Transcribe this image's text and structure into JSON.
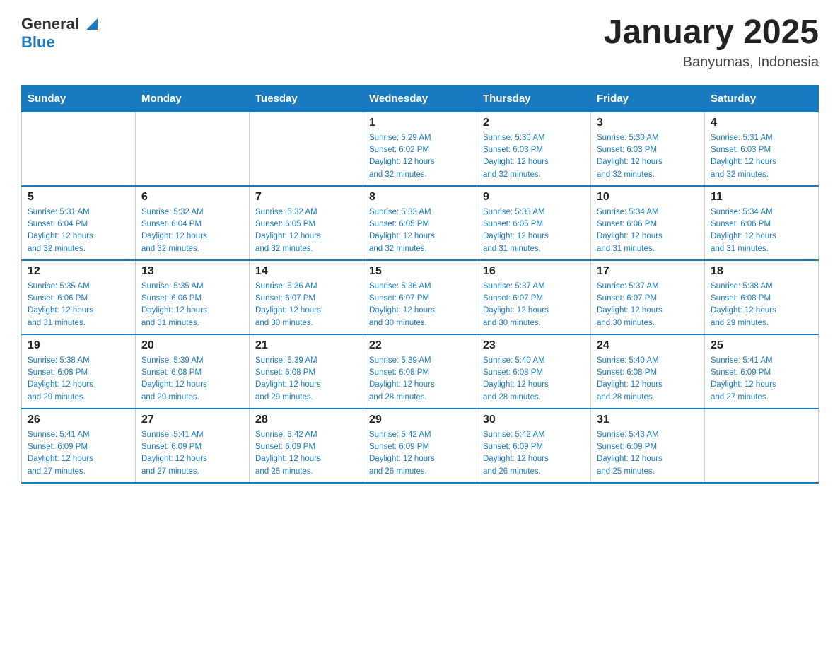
{
  "header": {
    "logo_text_general": "General",
    "logo_text_blue": "Blue",
    "month_title": "January 2025",
    "location": "Banyumas, Indonesia"
  },
  "days_of_week": [
    "Sunday",
    "Monday",
    "Tuesday",
    "Wednesday",
    "Thursday",
    "Friday",
    "Saturday"
  ],
  "weeks": [
    [
      {
        "day": "",
        "info": ""
      },
      {
        "day": "",
        "info": ""
      },
      {
        "day": "",
        "info": ""
      },
      {
        "day": "1",
        "info": "Sunrise: 5:29 AM\nSunset: 6:02 PM\nDaylight: 12 hours\nand 32 minutes."
      },
      {
        "day": "2",
        "info": "Sunrise: 5:30 AM\nSunset: 6:03 PM\nDaylight: 12 hours\nand 32 minutes."
      },
      {
        "day": "3",
        "info": "Sunrise: 5:30 AM\nSunset: 6:03 PM\nDaylight: 12 hours\nand 32 minutes."
      },
      {
        "day": "4",
        "info": "Sunrise: 5:31 AM\nSunset: 6:03 PM\nDaylight: 12 hours\nand 32 minutes."
      }
    ],
    [
      {
        "day": "5",
        "info": "Sunrise: 5:31 AM\nSunset: 6:04 PM\nDaylight: 12 hours\nand 32 minutes."
      },
      {
        "day": "6",
        "info": "Sunrise: 5:32 AM\nSunset: 6:04 PM\nDaylight: 12 hours\nand 32 minutes."
      },
      {
        "day": "7",
        "info": "Sunrise: 5:32 AM\nSunset: 6:05 PM\nDaylight: 12 hours\nand 32 minutes."
      },
      {
        "day": "8",
        "info": "Sunrise: 5:33 AM\nSunset: 6:05 PM\nDaylight: 12 hours\nand 32 minutes."
      },
      {
        "day": "9",
        "info": "Sunrise: 5:33 AM\nSunset: 6:05 PM\nDaylight: 12 hours\nand 31 minutes."
      },
      {
        "day": "10",
        "info": "Sunrise: 5:34 AM\nSunset: 6:06 PM\nDaylight: 12 hours\nand 31 minutes."
      },
      {
        "day": "11",
        "info": "Sunrise: 5:34 AM\nSunset: 6:06 PM\nDaylight: 12 hours\nand 31 minutes."
      }
    ],
    [
      {
        "day": "12",
        "info": "Sunrise: 5:35 AM\nSunset: 6:06 PM\nDaylight: 12 hours\nand 31 minutes."
      },
      {
        "day": "13",
        "info": "Sunrise: 5:35 AM\nSunset: 6:06 PM\nDaylight: 12 hours\nand 31 minutes."
      },
      {
        "day": "14",
        "info": "Sunrise: 5:36 AM\nSunset: 6:07 PM\nDaylight: 12 hours\nand 30 minutes."
      },
      {
        "day": "15",
        "info": "Sunrise: 5:36 AM\nSunset: 6:07 PM\nDaylight: 12 hours\nand 30 minutes."
      },
      {
        "day": "16",
        "info": "Sunrise: 5:37 AM\nSunset: 6:07 PM\nDaylight: 12 hours\nand 30 minutes."
      },
      {
        "day": "17",
        "info": "Sunrise: 5:37 AM\nSunset: 6:07 PM\nDaylight: 12 hours\nand 30 minutes."
      },
      {
        "day": "18",
        "info": "Sunrise: 5:38 AM\nSunset: 6:08 PM\nDaylight: 12 hours\nand 29 minutes."
      }
    ],
    [
      {
        "day": "19",
        "info": "Sunrise: 5:38 AM\nSunset: 6:08 PM\nDaylight: 12 hours\nand 29 minutes."
      },
      {
        "day": "20",
        "info": "Sunrise: 5:39 AM\nSunset: 6:08 PM\nDaylight: 12 hours\nand 29 minutes."
      },
      {
        "day": "21",
        "info": "Sunrise: 5:39 AM\nSunset: 6:08 PM\nDaylight: 12 hours\nand 29 minutes."
      },
      {
        "day": "22",
        "info": "Sunrise: 5:39 AM\nSunset: 6:08 PM\nDaylight: 12 hours\nand 28 minutes."
      },
      {
        "day": "23",
        "info": "Sunrise: 5:40 AM\nSunset: 6:08 PM\nDaylight: 12 hours\nand 28 minutes."
      },
      {
        "day": "24",
        "info": "Sunrise: 5:40 AM\nSunset: 6:08 PM\nDaylight: 12 hours\nand 28 minutes."
      },
      {
        "day": "25",
        "info": "Sunrise: 5:41 AM\nSunset: 6:09 PM\nDaylight: 12 hours\nand 27 minutes."
      }
    ],
    [
      {
        "day": "26",
        "info": "Sunrise: 5:41 AM\nSunset: 6:09 PM\nDaylight: 12 hours\nand 27 minutes."
      },
      {
        "day": "27",
        "info": "Sunrise: 5:41 AM\nSunset: 6:09 PM\nDaylight: 12 hours\nand 27 minutes."
      },
      {
        "day": "28",
        "info": "Sunrise: 5:42 AM\nSunset: 6:09 PM\nDaylight: 12 hours\nand 26 minutes."
      },
      {
        "day": "29",
        "info": "Sunrise: 5:42 AM\nSunset: 6:09 PM\nDaylight: 12 hours\nand 26 minutes."
      },
      {
        "day": "30",
        "info": "Sunrise: 5:42 AM\nSunset: 6:09 PM\nDaylight: 12 hours\nand 26 minutes."
      },
      {
        "day": "31",
        "info": "Sunrise: 5:43 AM\nSunset: 6:09 PM\nDaylight: 12 hours\nand 25 minutes."
      },
      {
        "day": "",
        "info": ""
      }
    ]
  ]
}
